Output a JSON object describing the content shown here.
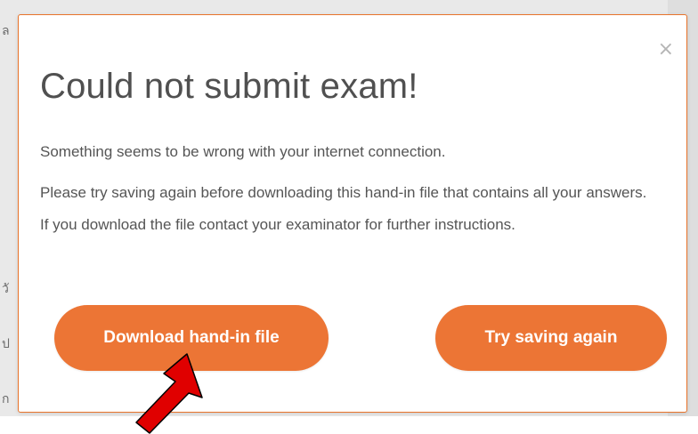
{
  "background": {
    "glyphs": [
      "ล",
      "วั",
      "ป",
      "ก"
    ]
  },
  "dialog": {
    "title": "Could not submit exam!",
    "paragraph1": "Something seems to be wrong with your internet connection.",
    "paragraph2": "Please try saving again before downloading this hand-in file that contains all your answers. If you download the file contact your examinator for further instructions.",
    "close_label": "×",
    "buttons": {
      "download": "Download hand-in file",
      "retry": "Try saving again"
    }
  },
  "colors": {
    "accent": "#ec7535",
    "modal_border": "#e8742b",
    "annotation_arrow": "#e00000"
  }
}
